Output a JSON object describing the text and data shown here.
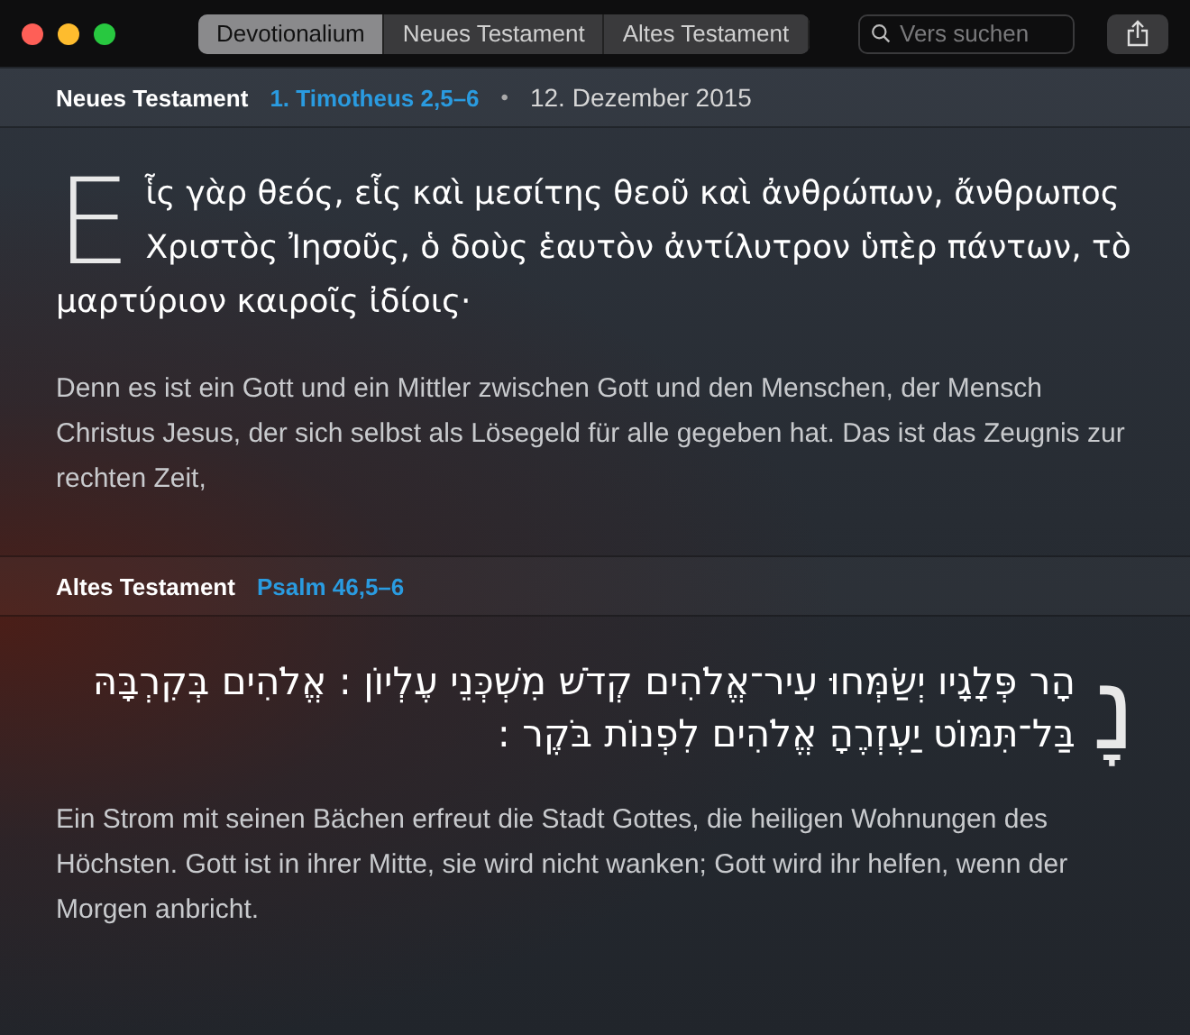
{
  "tabs": [
    {
      "label": "Devotionalium",
      "selected": true
    },
    {
      "label": "Neues Testament",
      "selected": false
    },
    {
      "label": "Altes Testament",
      "selected": false
    }
  ],
  "search": {
    "placeholder": "Vers suchen"
  },
  "sections": [
    {
      "kind": "ltr",
      "testament": "Neues Testament",
      "reference": "1. Timotheus 2,5–6",
      "separator": "•",
      "date": "12. Dezember 2015",
      "drop_cap": "Ε",
      "original": "ἷς γὰρ θεός, εἷς καὶ μεσίτης θεοῦ καὶ ἀνθρώπων, ἄνθρωπος Χριστὸς Ἰησοῦς, ὁ δοὺς ἑαυτὸν ἀντίλυτρον ὑπὲρ πάντων, τὸ μαρτύριον καιροῖς ἰδίοις·",
      "translation": "Denn es ist ein Gott und ein Mittler zwischen Gott und den Menschen, der Mensch Christus Jesus, der sich selbst als Lösegeld für alle gegeben hat. Das ist das Zeugnis zur rechten Zeit,"
    },
    {
      "kind": "rtl",
      "testament": "Altes Testament",
      "reference": "Psalm 46,5–6",
      "drop_cap": "נָ",
      "original": "הָר פְּלָגָיו יְשַׂמְּחוּ עִיר־אֱלֹהִים קְדֹשׁ מִשְׁכְּנֵי עֶלְיוֹן : אֱלֹהִים בְּקִרְבָּהּ בַּל־תִּמּוֹט יַעְזְרֶהָ אֱלֹהִים לִפְנוֹת בֹּקֶר :",
      "translation": "Ein Strom mit seinen Bächen erfreut die Stadt Gottes, die heiligen Wohnungen des Höchsten. Gott ist in ihrer Mitte, sie wird nicht wanken; Gott wird ihr helfen, wenn der Morgen anbricht."
    }
  ]
}
